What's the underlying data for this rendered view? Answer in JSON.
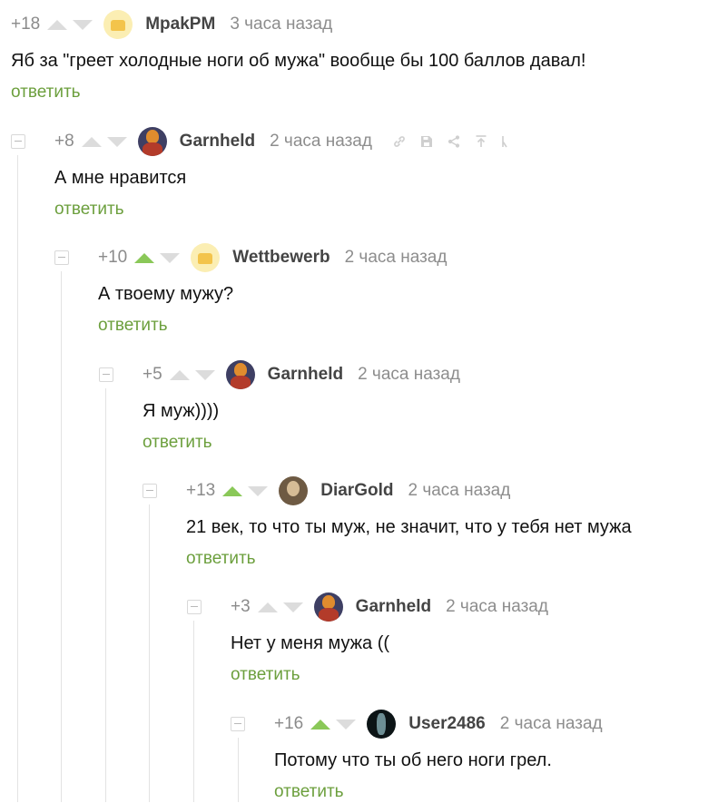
{
  "reply_label": "ответить",
  "comments": [
    {
      "rating": "+18",
      "upvoted": false,
      "author": "MpakPM",
      "time": "3 часа назад",
      "text": "Яб за \"греет холодные ноги об мужа\" вообще бы 100 баллов давал!",
      "avatar": "cheese-avatar"
    },
    {
      "rating": "+8",
      "upvoted": false,
      "author": "Garnheld",
      "time": "2 часа назад",
      "text": "А мне нравится",
      "avatar": "fox-avatar"
    },
    {
      "rating": "+10",
      "upvoted": true,
      "author": "Wettbewerb",
      "time": "2 часа назад",
      "text": "А твоему мужу?",
      "avatar": "cheese-avatar"
    },
    {
      "rating": "+5",
      "upvoted": false,
      "author": "Garnheld",
      "time": "2 часа назад",
      "text": "Я муж))))",
      "avatar": "fox-avatar"
    },
    {
      "rating": "+13",
      "upvoted": true,
      "author": "DiarGold",
      "time": "2 часа назад",
      "text": "21 век, то что ты муж, не значит, что у тебя нет мужа",
      "avatar": "photo-avatar"
    },
    {
      "rating": "+3",
      "upvoted": false,
      "author": "Garnheld",
      "time": "2 часа назад",
      "text": "Нет у меня мужа ((",
      "avatar": "fox-avatar"
    },
    {
      "rating": "+16",
      "upvoted": true,
      "author": "User2486",
      "time": "2 часа назад",
      "text": "Потому что ты об него ноги грел.",
      "avatar": "dark-avatar"
    }
  ],
  "hover_tools": [
    "link-icon",
    "save-icon",
    "share-icon",
    "scroll-up-icon",
    "more-icon"
  ],
  "colors": {
    "upvote_active": "#8ac858",
    "reply_link": "#6c9f3d",
    "arrow_inactive": "#dcdcdc"
  }
}
